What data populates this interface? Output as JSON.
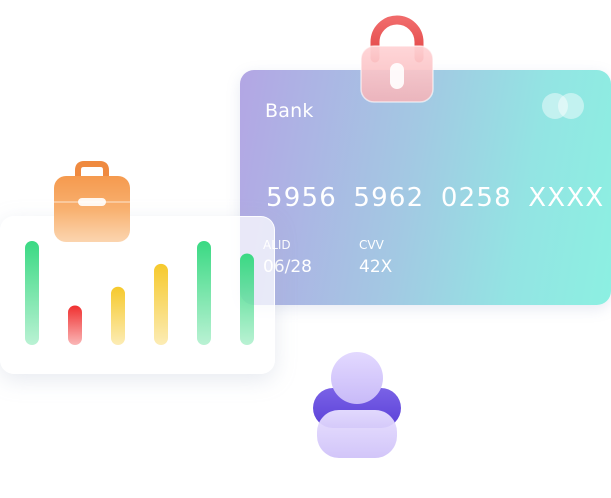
{
  "card": {
    "bank_name": "Bank",
    "number": "5956 5962 0258 XXXX",
    "valid_label": "ALID",
    "valid_value": "06/28",
    "cvv_label": "CVV",
    "cvv_value": "42X"
  },
  "icons": {
    "lock": "lock-icon",
    "briefcase": "briefcase-icon",
    "user": "user-icon",
    "card_logo": "card-brand-icon"
  },
  "chart_data": {
    "type": "bar",
    "values": [
      1.0,
      0.38,
      0.56,
      0.78,
      1.0,
      0.88
    ],
    "colors": [
      "#3ad983",
      "#f03030",
      "#f6c92c",
      "#f6c92c",
      "#3ad983",
      "#3ad983"
    ]
  }
}
